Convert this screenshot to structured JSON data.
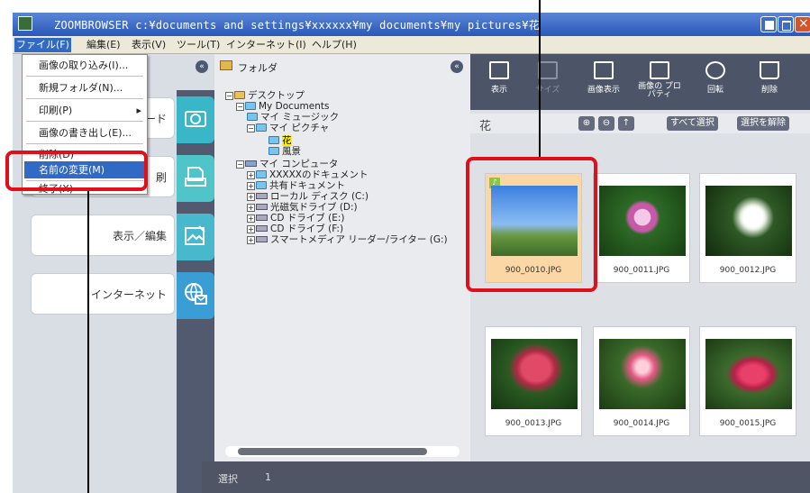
{
  "window": {
    "title": "ZOOMBROWSER c:¥documents and settings¥xxxxxx¥my documents¥my pictures¥花"
  },
  "menubar": [
    {
      "label": "ファイル(F)"
    },
    {
      "label": "編集(E)"
    },
    {
      "label": "表示(V)"
    },
    {
      "label": "ツール(T)"
    },
    {
      "label": "インターネット(I)"
    },
    {
      "label": "ヘルプ(H)"
    }
  ],
  "file_menu": {
    "items": [
      {
        "label": "画像の取り込み(I)..."
      },
      {
        "label": "新規フォルダ(N)..."
      },
      {
        "label": "印刷(P)",
        "arrow": "▸"
      },
      {
        "label": "画像の書き出し(E)..."
      },
      {
        "label": "削除(D)"
      },
      {
        "label": "名前の変更(M)"
      },
      {
        "label": "終了(X)"
      }
    ]
  },
  "left_panel": {
    "buttons": [
      {
        "label": "ード",
        "color": "#39b6c8"
      },
      {
        "label": "刷",
        "color": "#4fc4c9"
      },
      {
        "label": "表示／編集",
        "color": "#48b9cc"
      },
      {
        "label": "インターネット",
        "color": "#3a9ed4"
      }
    ]
  },
  "folder_panel": {
    "header": "フォルダ",
    "tree": [
      {
        "label": "デスクトップ"
      },
      {
        "label": "My Documents"
      },
      {
        "label": "マイ ミュージック"
      },
      {
        "label": "マイ ピクチャ"
      },
      {
        "label": "花"
      },
      {
        "label": "風景"
      },
      {
        "label": "マイ コンピュータ"
      },
      {
        "label": "XXXXXのドキュメント"
      },
      {
        "label": "共有ドキュメント"
      },
      {
        "label": "ローカル ディスク (C:)"
      },
      {
        "label": "光磁気ドライブ (D:)"
      },
      {
        "label": "CD ドライブ (E:)"
      },
      {
        "label": "CD ドライブ (F:)"
      },
      {
        "label": "スマートメディア リーダー/ライター (G:)"
      }
    ]
  },
  "toolbar": {
    "buttons": [
      {
        "label": "表示"
      },
      {
        "label": "サイズ"
      },
      {
        "label": "画像表示"
      },
      {
        "label": "画像の プロパティ"
      },
      {
        "label": "回転"
      },
      {
        "label": "削除"
      }
    ]
  },
  "pathbar": {
    "folder": "花",
    "select_all": "すべて選択",
    "deselect": "選択を解除"
  },
  "thumbnails": [
    {
      "filename": "900_0010.JPG"
    },
    {
      "filename": "900_0011.JPG"
    },
    {
      "filename": "900_0012.JPG"
    },
    {
      "filename": "900_0013.JPG"
    },
    {
      "filename": "900_0014.JPG"
    },
    {
      "filename": "900_0015.JPG"
    }
  ],
  "status": {
    "label": "選択",
    "count": "1"
  },
  "colors": {
    "accent": "#316ac5",
    "highlight": "#e0101a",
    "selected_thumb": "#fbd7a6"
  }
}
